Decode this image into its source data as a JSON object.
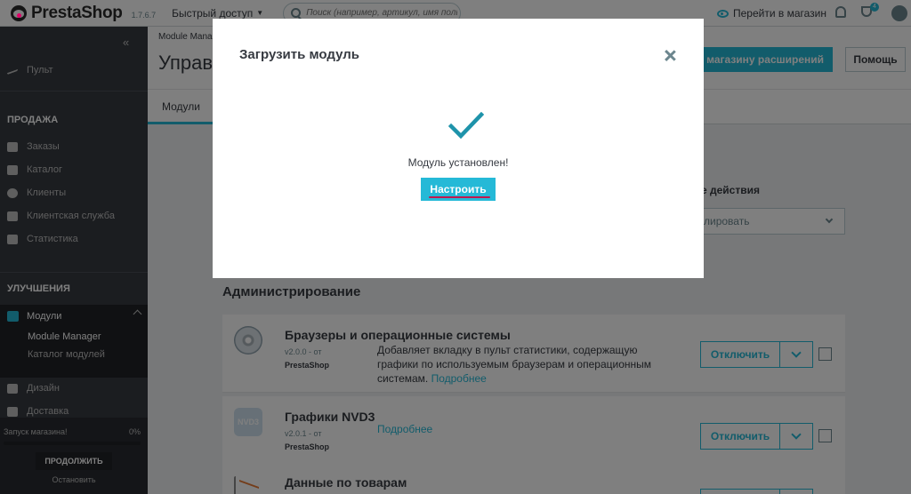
{
  "header": {
    "logo_text": "PrestaShop",
    "version": "1.7.6.7",
    "quick_access": "Быстрый доступ",
    "search_placeholder": "Поиск (например, артикул, имя поль",
    "goto_store": "Перейти в магазин",
    "notifications_badge": "4"
  },
  "sidebar": {
    "dashboard": "Пульт",
    "sell_title": "ПРОДАЖА",
    "sell_items": [
      "Заказы",
      "Каталог",
      "Клиенты",
      "Клиентская служба",
      "Статистика"
    ],
    "improve_title": "УЛУЧШЕНИЯ",
    "modules": "Модули",
    "modules_sub": [
      "Module Manager",
      "Каталог модулей"
    ],
    "design": "Дизайн",
    "shipping": "Доставка",
    "launch_label": "Запуск магазина!",
    "launch_percent": "0%",
    "continue": "ПРОДОЛЖИТЬ",
    "stop": "Остановить"
  },
  "page": {
    "breadcrumb": "Module Mana",
    "title": "Управ",
    "addons_button": "магазину расширений",
    "help_button": "Помощь",
    "tab_modules": "Модули",
    "bulk_label": "е действия",
    "bulk_value": "лировать"
  },
  "category": "Администрирование",
  "modules": [
    {
      "name": "Браузеры и операционные системы",
      "version": "v2.0.0 - от",
      "author": "PrestaShop",
      "description": "Добавляет вкладку в пульт статистики, содержащую графики по используемым браузерам и операционным системам.",
      "more": "Подробнее",
      "action": "Отключить"
    },
    {
      "name": "Графики NVD3",
      "version": "v2.0.1 - от",
      "author": "PrestaShop",
      "icon_text": "NVD3",
      "description": "",
      "more": "Подробнее",
      "action": "Отключить"
    },
    {
      "name": "Данные по товарам",
      "version": "",
      "author": "",
      "description": "",
      "more": "",
      "action": ""
    }
  ],
  "modal": {
    "title": "Загрузить модуль",
    "message": "Модуль установлен!",
    "configure": "Настроить"
  },
  "colors": {
    "accent": "#25b9d7",
    "sidebar": "#363a41",
    "underline": "#c0184f"
  }
}
